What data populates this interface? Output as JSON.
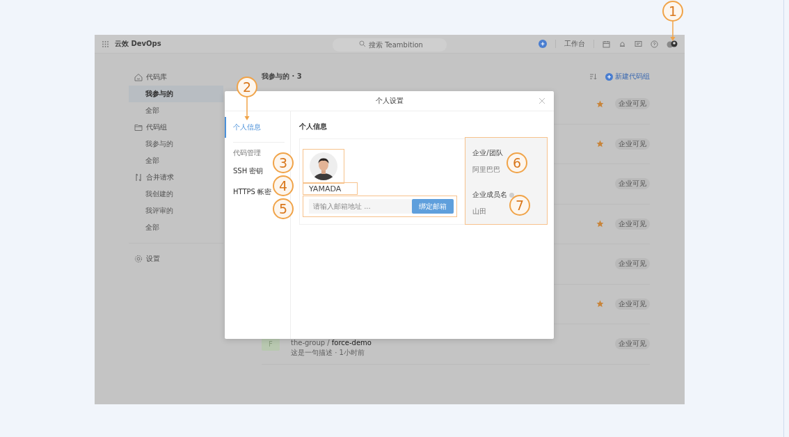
{
  "app": {
    "logo_text": "云效 DevOps",
    "search": {
      "placeholder": "搜索 Teambition"
    },
    "workbench": "工作台"
  },
  "sidebar": {
    "sections": [
      {
        "title": "代码库",
        "items": [
          {
            "label": "我参与的",
            "selected": true
          },
          {
            "label": "全部",
            "selected": false
          }
        ]
      },
      {
        "title": "代码组",
        "items": [
          {
            "label": "我参与的",
            "selected": false
          },
          {
            "label": "全部",
            "selected": false
          }
        ]
      },
      {
        "title": "合并请求",
        "items": [
          {
            "label": "我创建的",
            "selected": false
          },
          {
            "label": "我评审的",
            "selected": false
          },
          {
            "label": "全部",
            "selected": false
          }
        ]
      }
    ],
    "settings": "设置"
  },
  "main": {
    "heading": "我参与的 · 3",
    "new_button": "新建代码组",
    "rows": [
      {
        "starred": true,
        "badge": "企业可见"
      },
      {
        "starred": true,
        "badge": "企业可见"
      },
      {
        "starred": false,
        "badge": "企业可见"
      },
      {
        "starred": true,
        "badge": "企业可见"
      },
      {
        "starred": false,
        "badge": "企业可见"
      },
      {
        "starred": true,
        "badge": "企业可见"
      },
      {
        "starred": false,
        "badge": "企业可见",
        "avatar_letter": "F",
        "group": "the-group",
        "separator": "/",
        "name": "force-demo",
        "description": "这是一句描述",
        "dot": "·",
        "time": "1小时前"
      }
    ]
  },
  "dialog": {
    "title": "个人设置",
    "nav": [
      {
        "kind": "item",
        "label": "个人信息",
        "selected": true
      },
      {
        "kind": "heading",
        "label": "代码管理"
      },
      {
        "kind": "item",
        "label": "SSH 密钥",
        "selected": false
      },
      {
        "kind": "item",
        "label": "HTTPS 帐密",
        "selected": false
      }
    ],
    "section_title": "个人信息",
    "user_name": "YAMADA",
    "email": {
      "placeholder": "请输入邮箱地址 ...",
      "button": "绑定邮箱"
    },
    "org_label": "企业/团队",
    "org_value": "阿里巴巴",
    "member_label": "企业成员名",
    "member_value": "山田"
  },
  "callouts": [
    {
      "number": "1",
      "pointer": true
    },
    {
      "number": "2",
      "pointer": true
    },
    {
      "number": "3",
      "pointer": false
    },
    {
      "number": "4",
      "pointer": false
    },
    {
      "number": "5",
      "pointer": false
    },
    {
      "number": "6",
      "pointer": false
    },
    {
      "number": "7",
      "pointer": false
    }
  ]
}
